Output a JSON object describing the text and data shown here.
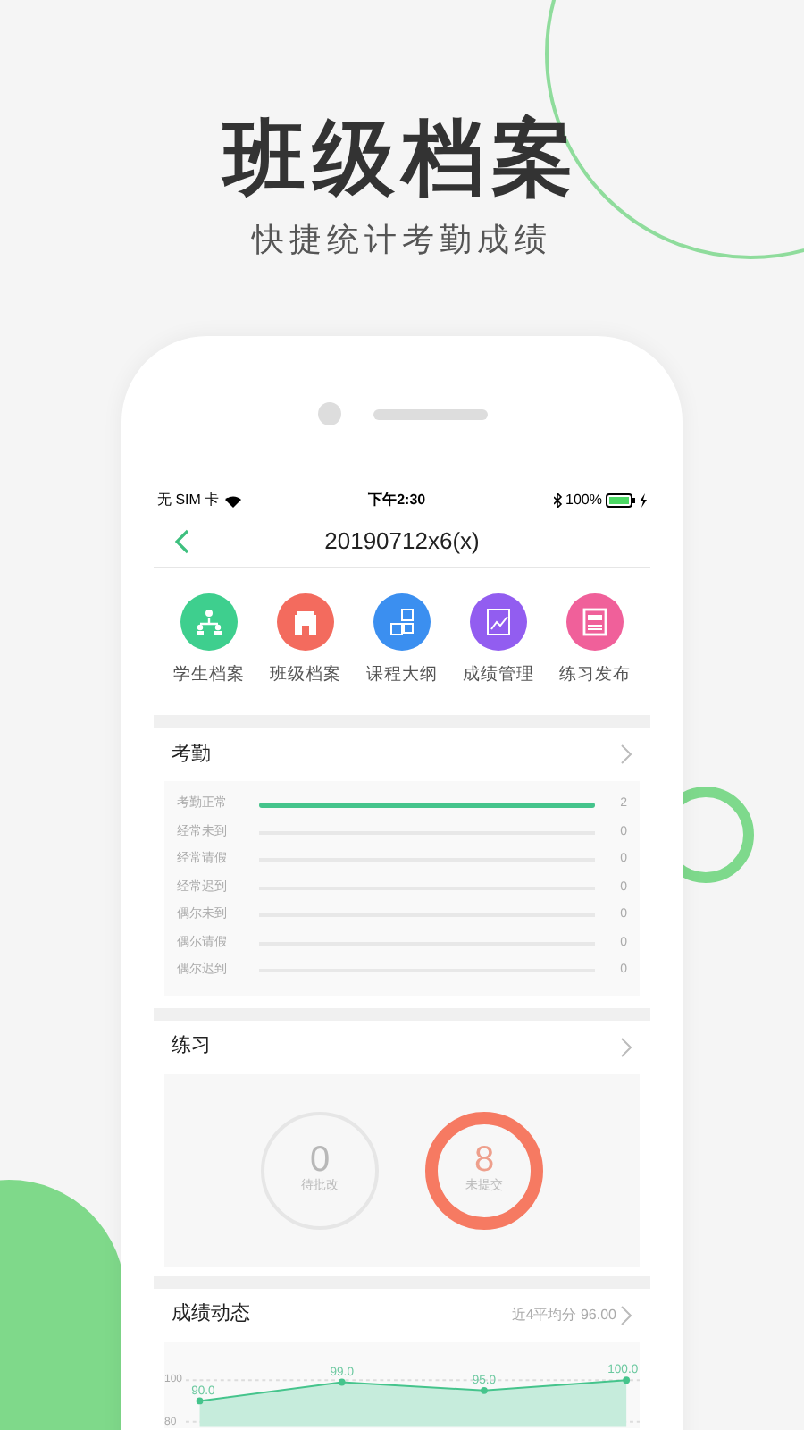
{
  "hero": {
    "title": "班级档案",
    "subtitle": "快捷统计考勤成绩"
  },
  "status_bar": {
    "carrier": "无 SIM 卡",
    "time": "下午2:30",
    "battery": "100%"
  },
  "nav": {
    "title": "20190712x6(x)"
  },
  "shortcuts": [
    {
      "label": "学生档案",
      "kind": "people",
      "color": "#3ecf8e"
    },
    {
      "label": "班级档案",
      "kind": "building",
      "color": "#f36b5e"
    },
    {
      "label": "课程大纲",
      "kind": "abc",
      "color": "#3b8ff0"
    },
    {
      "label": "成绩管理",
      "kind": "chart",
      "color": "#925df0"
    },
    {
      "label": "练习发布",
      "kind": "doc",
      "color": "#f0609a"
    }
  ],
  "attendance": {
    "title": "考勤",
    "rows": [
      {
        "label": "考勤正常",
        "level": 1,
        "count": "2"
      },
      {
        "label": "经常未到",
        "level": 0,
        "count": "0"
      },
      {
        "label": "经常请假",
        "level": 0,
        "count": "0"
      },
      {
        "label": "经常迟到",
        "level": 0,
        "count": "0"
      },
      {
        "label": "偶尔未到",
        "level": 0,
        "count": "0"
      },
      {
        "label": "偶尔请假",
        "level": 0,
        "count": "0"
      },
      {
        "label": "偶尔迟到",
        "level": 0,
        "count": "0"
      }
    ]
  },
  "practice": {
    "title": "练习",
    "stats": [
      {
        "value": "0",
        "label": "待批改",
        "kind": "idle"
      },
      {
        "value": "8",
        "label": "未提交",
        "kind": "alert"
      }
    ]
  },
  "scores": {
    "title": "成绩动态",
    "summary": "近4平均分 96.00",
    "chart_data": {
      "type": "line",
      "marker": "circle",
      "values": [
        90,
        99,
        95,
        100
      ],
      "ylim": [
        80,
        100
      ],
      "yticks": [
        80,
        100
      ],
      "value_labels": [
        "90.0",
        "99.0",
        "95.0",
        "100.0"
      ]
    }
  }
}
